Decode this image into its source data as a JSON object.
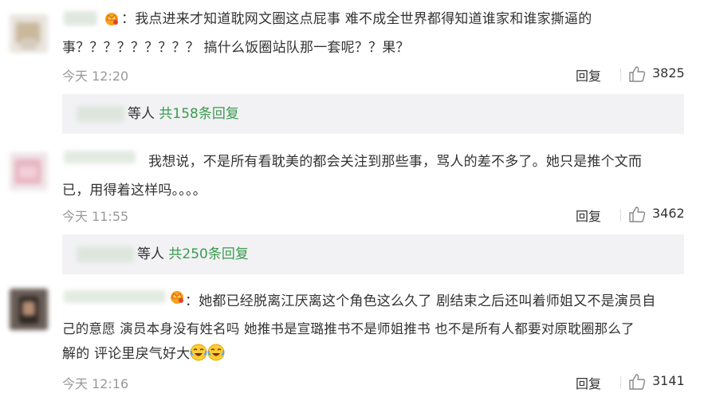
{
  "comments": [
    {
      "text_line1": "我点进来才知道耽网文圈这点屁事  难不成全世界都得知道谁家和谁家撕逼的",
      "text_line2": "事？？？？？？？？？  搞什么饭圈站队那一套呢？？果？",
      "time": "今天 12:20",
      "reply_label": "回复",
      "likes": "3825",
      "replies_people": "等人",
      "replies_total": "共158条回复"
    },
    {
      "text_line1": "我想说，不是所有看耽美的都会关注到那些事，骂人的差不多了。她只是推个文而",
      "text_line2": "已，用得着这样吗。。。。",
      "time": "今天 11:55",
      "reply_label": "回复",
      "likes": "3462",
      "replies_people": "等人",
      "replies_total": "共250条回复"
    },
    {
      "text_line1": "：她都已经脱离江厌离这个角色这么久了 剧结束之后还叫着师姐又不是演员自",
      "text_line2": "己的意愿  演员本身没有姓名吗 她推书是宣璐推书不是师姐推书 也不是所有人都要对原耽圈那么了",
      "text_line3": "解的 评论里戾气好大",
      "time": "今天 12:16",
      "reply_label": "回复",
      "likes": "3141"
    }
  ],
  "colon": "：",
  "icons": {
    "like": "thumbs-up-icon",
    "vip": "crown-icon",
    "emoji": "crying-laugh-emoji"
  },
  "colors": {
    "link_green": "#3a9b4f",
    "muted": "#999999",
    "text": "#333333",
    "reply_bg": "#f2f2f5"
  }
}
